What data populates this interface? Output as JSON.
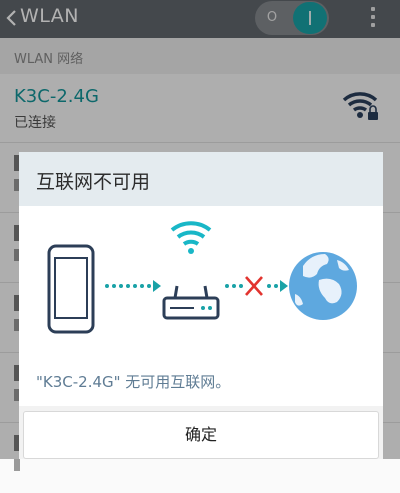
{
  "appbar": {
    "title": "WLAN",
    "back_icon": "chevron-left-icon",
    "toggle_off_symbol": "O",
    "toggle_state": "on",
    "menu_icon": "kebab-menu-icon"
  },
  "section": {
    "label": "WLAN 网络"
  },
  "network": {
    "name": "K3C-2.4G",
    "status": "已连接",
    "icon": "wifi-locked-icon"
  },
  "dialog": {
    "title": "互联网不可用",
    "message": "\"K3C-2.4G\" 无可用互联网。",
    "confirm_label": "确定",
    "illustration_icons": [
      "phone-icon",
      "router-icon",
      "globe-icon"
    ]
  },
  "colors": {
    "accent": "#19a2a7",
    "appbar": "#62676d",
    "error": "#e2342f",
    "message": "#5f7c94"
  }
}
